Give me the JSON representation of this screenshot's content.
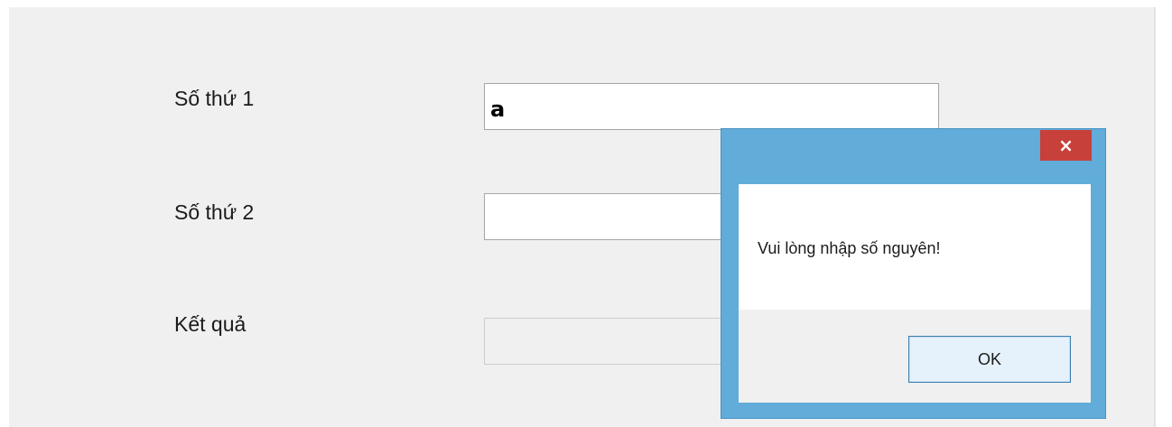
{
  "form": {
    "fields": [
      {
        "label": "Số thứ 1",
        "value": "a"
      },
      {
        "label": "Số thứ 2",
        "value": ""
      },
      {
        "label": "Kết quả",
        "value": ""
      }
    ]
  },
  "message_box": {
    "close_glyph": "×",
    "message": "Vui lòng nhập số nguyên!",
    "ok_label": "OK",
    "title_bar_color": "#61acd9",
    "close_button_color": "#c7403a"
  }
}
